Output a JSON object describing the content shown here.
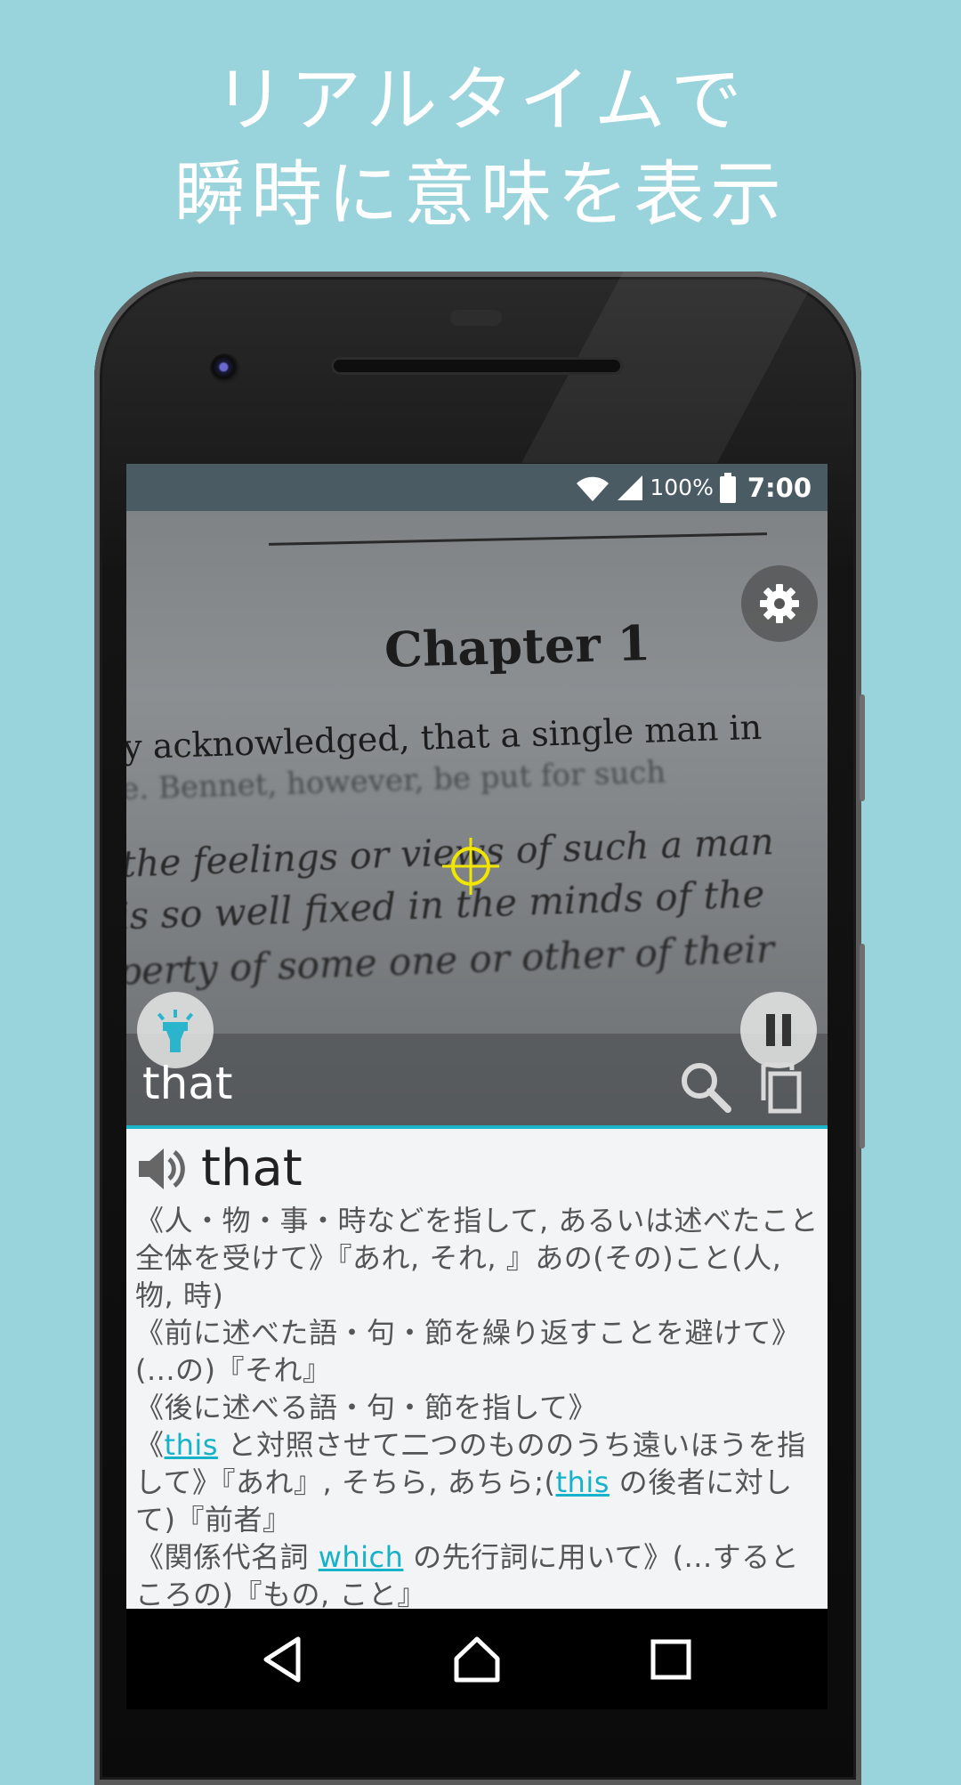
{
  "promo": {
    "headline_line1": "リアルタイムで",
    "headline_line2": "瞬時に意味を表示"
  },
  "status_bar": {
    "battery_percent": "100%",
    "time": "7:00",
    "icons": [
      "wifi-icon",
      "signal-icon",
      "battery-icon"
    ]
  },
  "camera": {
    "chapter_title": "Chapter 1",
    "line1": "y acknowledged, that a single man in",
    "line2": "e.   Bennet, however, be put for such",
    "line3": "the feelings or views of such a man",
    "line4": "is so well fixed in the minds of the",
    "line5": "perty of some one or other of their"
  },
  "result": {
    "recognized_word": "that",
    "search_icon": "search-icon",
    "copy_icon": "copy-icon"
  },
  "dictionary": {
    "headword": "that",
    "entries": [
      "《人・物・事・時などを指して, あるいは述べたこと全体を受けて》『あれ, それ, 』あの(その)こと(人, 物, 時)",
      "《前に述べた語・句・節を繰り返すことを避けて》(...の)『それ』",
      "《後に述べる語・句・節を指して》"
    ],
    "entry4_pre": "《",
    "entry4_link1": "this",
    "entry4_mid": " と対照させて二つのもののうち遠いほうを指して》『あれ』, そちら, あちら;(",
    "entry4_link2": "this",
    "entry4_post": " の後者に対して)『前者』",
    "entry5_pre": "《関係代名詞 ",
    "entry5_link": "which",
    "entry5_post": " の先行詞に用いて》(...するところの)『もの, こと』"
  },
  "colors": {
    "background": "#99d3db",
    "accent": "#1eb4c8",
    "crosshair": "#f2e600",
    "statusbar": "#4b5b64"
  }
}
